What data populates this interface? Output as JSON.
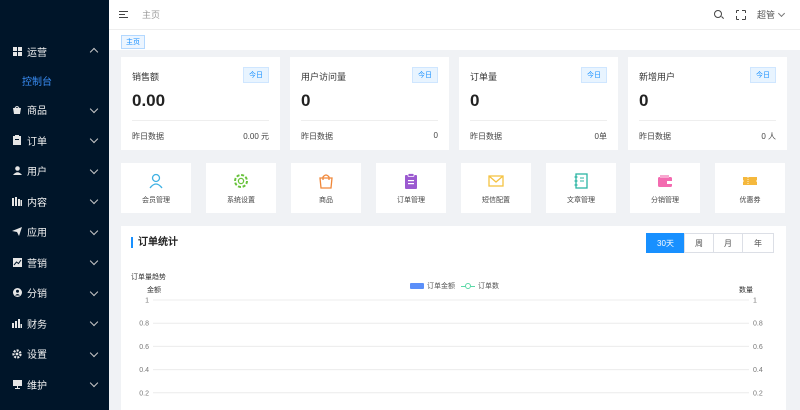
{
  "sidebar": {
    "items": [
      {
        "label": "运营",
        "icon": "grid-icon",
        "expanded": true
      },
      {
        "label": "商品",
        "icon": "bag-icon"
      },
      {
        "label": "订单",
        "icon": "clipboard-icon"
      },
      {
        "label": "用户",
        "icon": "user-icon"
      },
      {
        "label": "内容",
        "icon": "book-icon"
      },
      {
        "label": "应用",
        "icon": "send-icon"
      },
      {
        "label": "营销",
        "icon": "chart-icon"
      },
      {
        "label": "分销",
        "icon": "user-circle-icon"
      },
      {
        "label": "财务",
        "icon": "finance-icon"
      },
      {
        "label": "设置",
        "icon": "gear-icon"
      },
      {
        "label": "维护",
        "icon": "monitor-icon"
      }
    ],
    "active_sub": "控制台"
  },
  "header": {
    "breadcrumb": "主页",
    "user_name": "超管"
  },
  "tags": {
    "current": "主页"
  },
  "stats": [
    {
      "title": "销售额",
      "badge": "今日",
      "value": "0.00",
      "foot_label": "昨日数据",
      "foot_value": "0.00 元"
    },
    {
      "title": "用户访问量",
      "badge": "今日",
      "value": "0",
      "foot_label": "昨日数据",
      "foot_value": "0"
    },
    {
      "title": "订单量",
      "badge": "今日",
      "value": "0",
      "foot_label": "昨日数据",
      "foot_value": "0单"
    },
    {
      "title": "新增用户",
      "badge": "今日",
      "value": "0",
      "foot_label": "昨日数据",
      "foot_value": "0 人"
    }
  ],
  "quick": [
    {
      "label": "会员管理",
      "icon": "member-icon",
      "color": "#3fb1e3"
    },
    {
      "label": "系统设置",
      "icon": "settings-icon",
      "color": "#67c23a"
    },
    {
      "label": "商品",
      "icon": "shopping-bag-icon",
      "color": "#f0883a"
    },
    {
      "label": "订单管理",
      "icon": "order-icon",
      "color": "#9b59d0"
    },
    {
      "label": "短信配置",
      "icon": "mail-icon",
      "color": "#f5c242"
    },
    {
      "label": "文章管理",
      "icon": "notebook-icon",
      "color": "#2bb5a3"
    },
    {
      "label": "分销管理",
      "icon": "wallet-icon",
      "color": "#f36bb0"
    },
    {
      "label": "优惠券",
      "icon": "coupon-icon",
      "color": "#f5b83c"
    }
  ],
  "panel": {
    "title": "订单统计",
    "ranges": [
      "30天",
      "周",
      "月",
      "年"
    ],
    "active_range": "30天"
  },
  "chart_data": {
    "type": "bar",
    "title": "订单量趋势",
    "ylabel_left": "金额",
    "ylabel_right": "数量",
    "series": [
      {
        "name": "订单金额",
        "type": "bar",
        "color": "#5b8ff9",
        "values": []
      },
      {
        "name": "订单数",
        "type": "line",
        "color": "#5ad8a6",
        "values": []
      }
    ],
    "yticks": [
      1,
      0.8,
      0.6,
      0.4,
      0.2
    ],
    "ylim": [
      0,
      1
    ],
    "grid": true,
    "legend": "top-center"
  }
}
